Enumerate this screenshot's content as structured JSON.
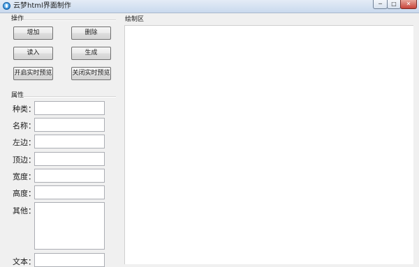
{
  "window": {
    "title": "云梦html界面制作",
    "controls": {
      "minimize": "─",
      "maximize": "□",
      "close": "✕"
    }
  },
  "operations": {
    "title": "操作",
    "buttons": {
      "add": "增加",
      "delete": "删除",
      "read": "读入",
      "generate": "生成",
      "start_preview": "开启实时预览",
      "stop_preview": "关闭实时预览"
    }
  },
  "properties": {
    "title": "属性",
    "fields": {
      "type": {
        "label": "种类：",
        "value": ""
      },
      "name": {
        "label": "名称：",
        "value": ""
      },
      "left": {
        "label": "左边：",
        "value": ""
      },
      "top": {
        "label": "顶边：",
        "value": ""
      },
      "width": {
        "label": "宽度：",
        "value": ""
      },
      "height": {
        "label": "高度：",
        "value": ""
      },
      "other": {
        "label": "其他：",
        "value": ""
      },
      "text": {
        "label": "文本：",
        "value": ""
      }
    }
  },
  "drawing": {
    "title": "绘制区"
  },
  "colors": {
    "background": "#f0f0f0",
    "canvas": "#ffffff",
    "titlebar": "#c9d9ee",
    "close_button": "#c7443a"
  }
}
